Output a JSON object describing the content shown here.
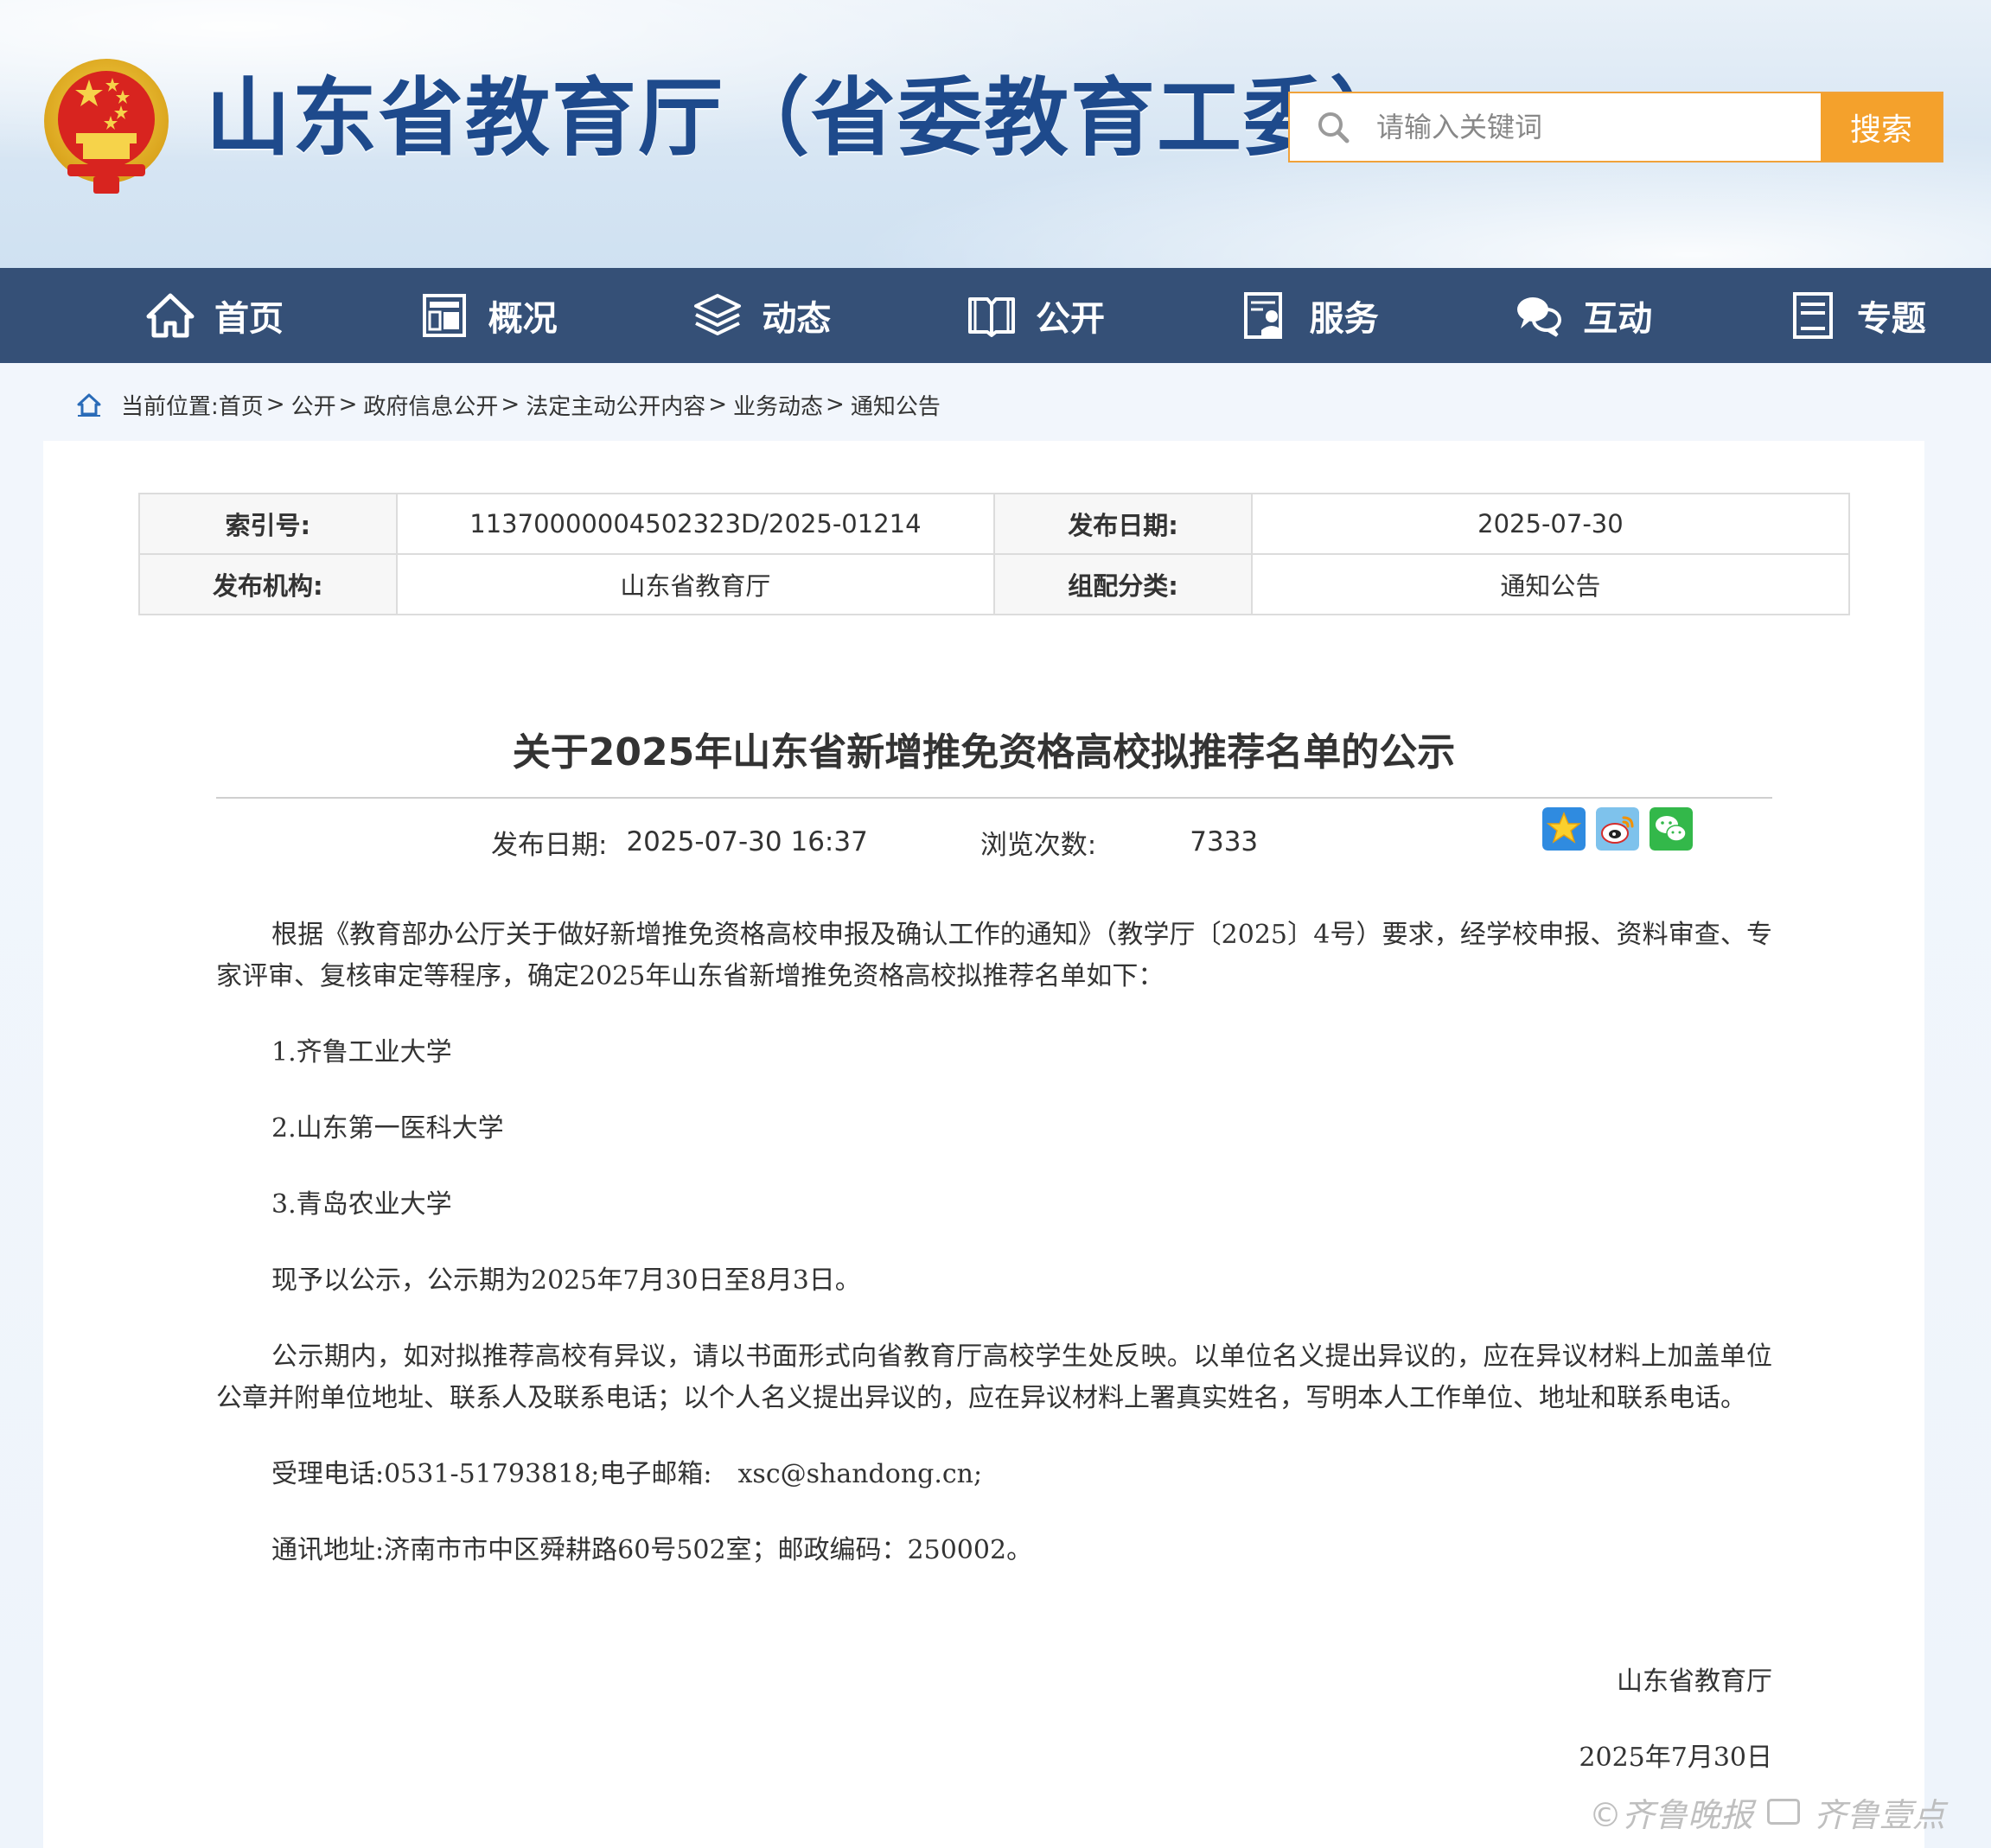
{
  "site": {
    "title": "山东省教育厅（省委教育工委）"
  },
  "search": {
    "placeholder": "请输入关键词",
    "button_label": "搜索"
  },
  "nav": {
    "items": [
      {
        "label": "首页",
        "icon": "home-icon"
      },
      {
        "label": "概况",
        "icon": "overview-icon"
      },
      {
        "label": "动态",
        "icon": "layers-icon"
      },
      {
        "label": "公开",
        "icon": "book-icon"
      },
      {
        "label": "服务",
        "icon": "service-icon"
      },
      {
        "label": "互动",
        "icon": "chat-icon"
      },
      {
        "label": "专题",
        "icon": "topic-icon"
      }
    ]
  },
  "breadcrumb": {
    "prefix": "当前位置:",
    "items": [
      "首页",
      "公开",
      "政府信息公开",
      "法定主动公开内容",
      "业务动态",
      "通知公告"
    ],
    "separator": ">"
  },
  "meta": {
    "index_label": "索引号:",
    "index_value": "11370000004502323D/2025-01214",
    "publish_date_label": "发布日期:",
    "publish_date_value": "2025-07-30",
    "org_label": "发布机构:",
    "org_value": "山东省教育厅",
    "category_label": "组配分类:",
    "category_value": "通知公告"
  },
  "article": {
    "title": "关于2025年山东省新增推免资格高校拟推荐名单的公示",
    "date_label": "发布日期:",
    "date_value": "2025-07-30 16:37",
    "views_label": "浏览次数:",
    "views_value": "7333",
    "paragraphs": [
      "根据《教育部办公厅关于做好新增推免资格高校申报及确认工作的通知》（教学厅〔2025〕4号）要求，经学校申报、资料审查、专家评审、复核审定等程序，确定2025年山东省新增推免资格高校拟推荐名单如下：",
      "1.齐鲁工业大学",
      "2.山东第一医科大学",
      "3.青岛农业大学",
      "现予以公示，公示期为2025年7月30日至8月3日。",
      "公示期内，如对拟推荐高校有异议，请以书面形式向省教育厅高校学生处反映。以单位名义提出异议的，应在异议材料上加盖单位公章并附单位地址、联系人及联系电话；以个人名义提出异议的，应在异议材料上署真实姓名，写明本人工作单位、地址和联系电话。",
      "受理电话:0531-51793818;电子邮箱:　xsc@shandong.cn;",
      "通讯地址:济南市市中区舜耕路60号502室；邮政编码：250002。"
    ],
    "signature_org": "山东省教育厅",
    "signature_date": "2025年7月30日"
  },
  "share": [
    "qzone-share-icon",
    "weibo-share-icon",
    "wechat-share-icon"
  ],
  "watermark": {
    "text1": "©齐鲁晚报",
    "text2": "齐鲁壹点"
  },
  "colors": {
    "nav_bg": "#355077",
    "title_blue": "#1e4a8c",
    "search_orange": "#f4a12c"
  }
}
